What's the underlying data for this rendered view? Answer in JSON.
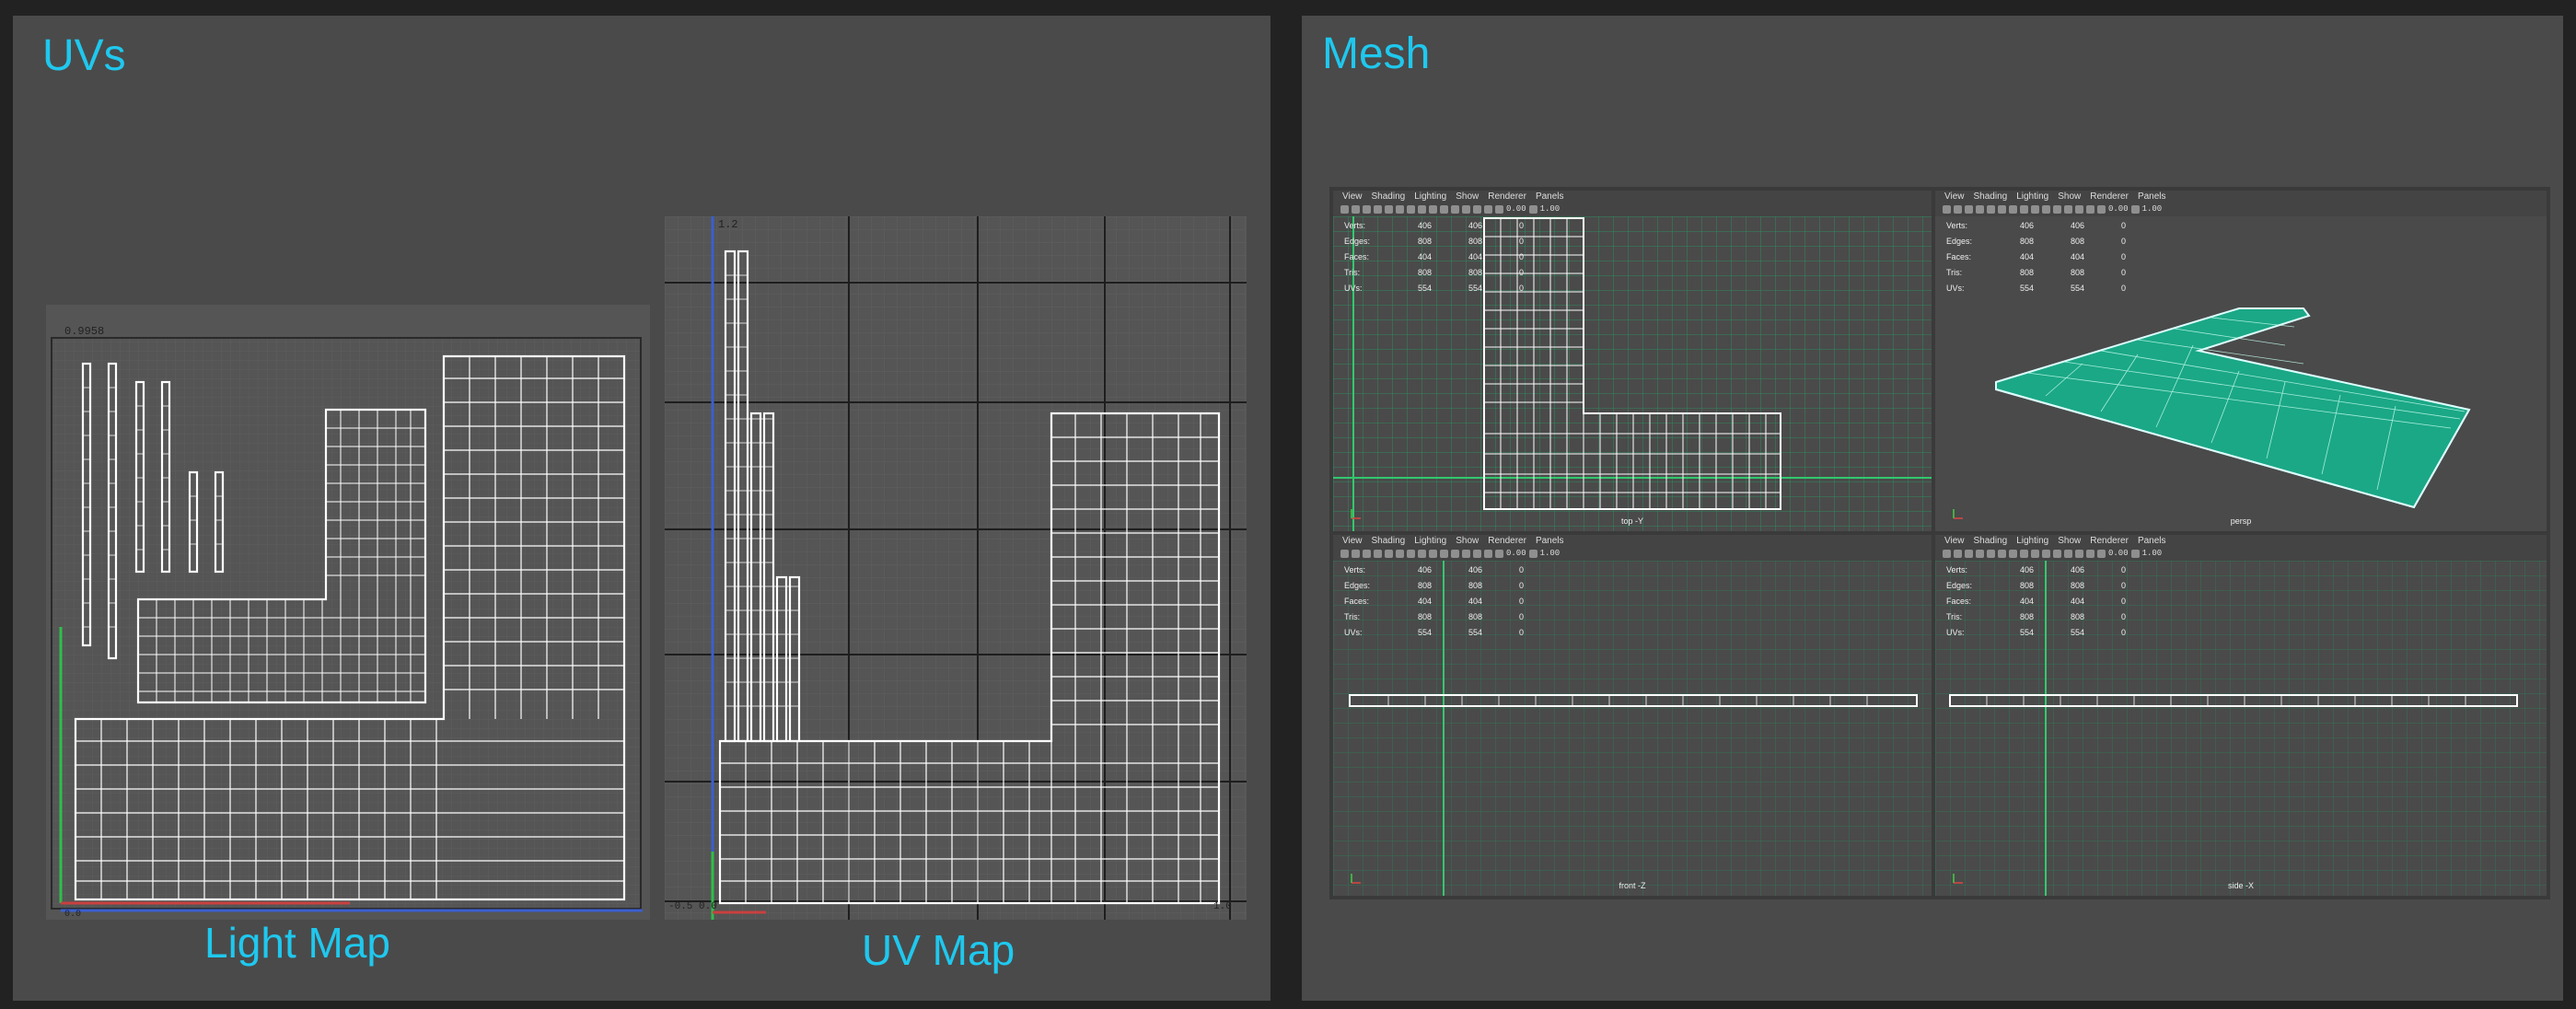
{
  "left_panel": {
    "title": "UVs",
    "light_map": {
      "caption": "Light Map",
      "top_value": "0.9958",
      "corner_label": "0.0"
    },
    "uv_map": {
      "caption": "UV Map",
      "top_value": "1.2",
      "bottom_left_label": "-0.5 0.0",
      "bottom_right_label": "1.0"
    }
  },
  "right_panel": {
    "title": "Mesh",
    "menu": [
      "View",
      "Shading",
      "Lighting",
      "Show",
      "Renderer",
      "Panels"
    ],
    "toolbar_values": [
      "0.00",
      "1.00"
    ],
    "stats": [
      {
        "label": "Verts:",
        "a": "406",
        "b": "406",
        "c": "0"
      },
      {
        "label": "Edges:",
        "a": "808",
        "b": "808",
        "c": "0"
      },
      {
        "label": "Faces:",
        "a": "404",
        "b": "404",
        "c": "0"
      },
      {
        "label": "Tris:",
        "a": "808",
        "b": "808",
        "c": "0"
      },
      {
        "label": "UVs:",
        "a": "554",
        "b": "554",
        "c": "0"
      }
    ],
    "viewports": [
      {
        "camera": "top -Y"
      },
      {
        "camera": "persp"
      },
      {
        "camera": "front -Z"
      },
      {
        "camera": "side -X"
      }
    ]
  },
  "colors": {
    "background": "#222222",
    "panel": "#4a4a4a",
    "title_accent": "#1fc8ee",
    "mesh_fill": "#1ba886",
    "grid_green": "#2bb86a"
  }
}
